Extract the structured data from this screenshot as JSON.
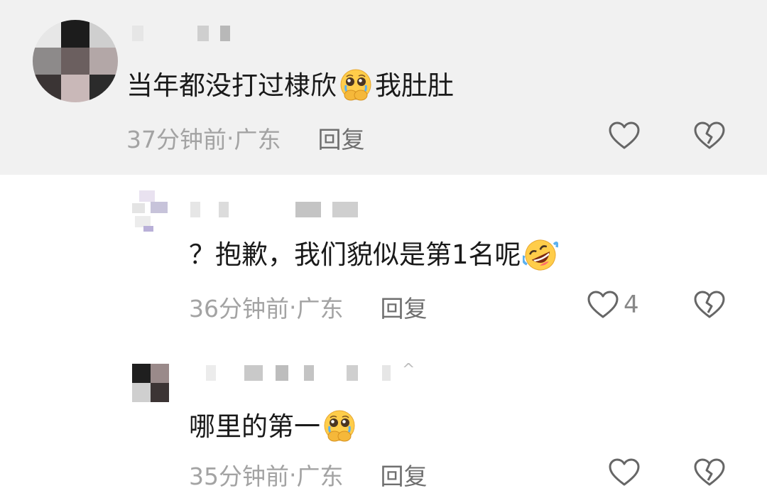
{
  "comments": [
    {
      "text_before": "当年都没打过棣欣",
      "emoji": "pleading-face-hands",
      "text_after": "我肚肚",
      "time": "37分钟前",
      "sep": " · ",
      "location": "广东",
      "reply_label": "回复",
      "like_count": "",
      "highlighted": true
    },
    {
      "text_before": "？抱歉，我们貌似是第1名呢",
      "emoji": "rolling-laughing-face",
      "text_after": "",
      "time": "36分钟前",
      "sep": " · ",
      "location": "广东",
      "reply_label": "回复",
      "like_count": "4"
    },
    {
      "text_before": "哪里的第一",
      "emoji": "pleading-face-hands",
      "text_after": "",
      "time": "35分钟前",
      "sep": " · ",
      "location": "广东",
      "reply_label": "回复",
      "like_count": "",
      "name_suffix": "^"
    }
  ],
  "icons": {
    "like": "heart-outline-icon",
    "dislike": "broken-heart-outline-icon"
  },
  "colors": {
    "highlight_bg": "#f1f1f1",
    "meta_text": "#a3a3a3",
    "reply_text": "#6f6f6f",
    "icon_stroke": "#666666"
  }
}
